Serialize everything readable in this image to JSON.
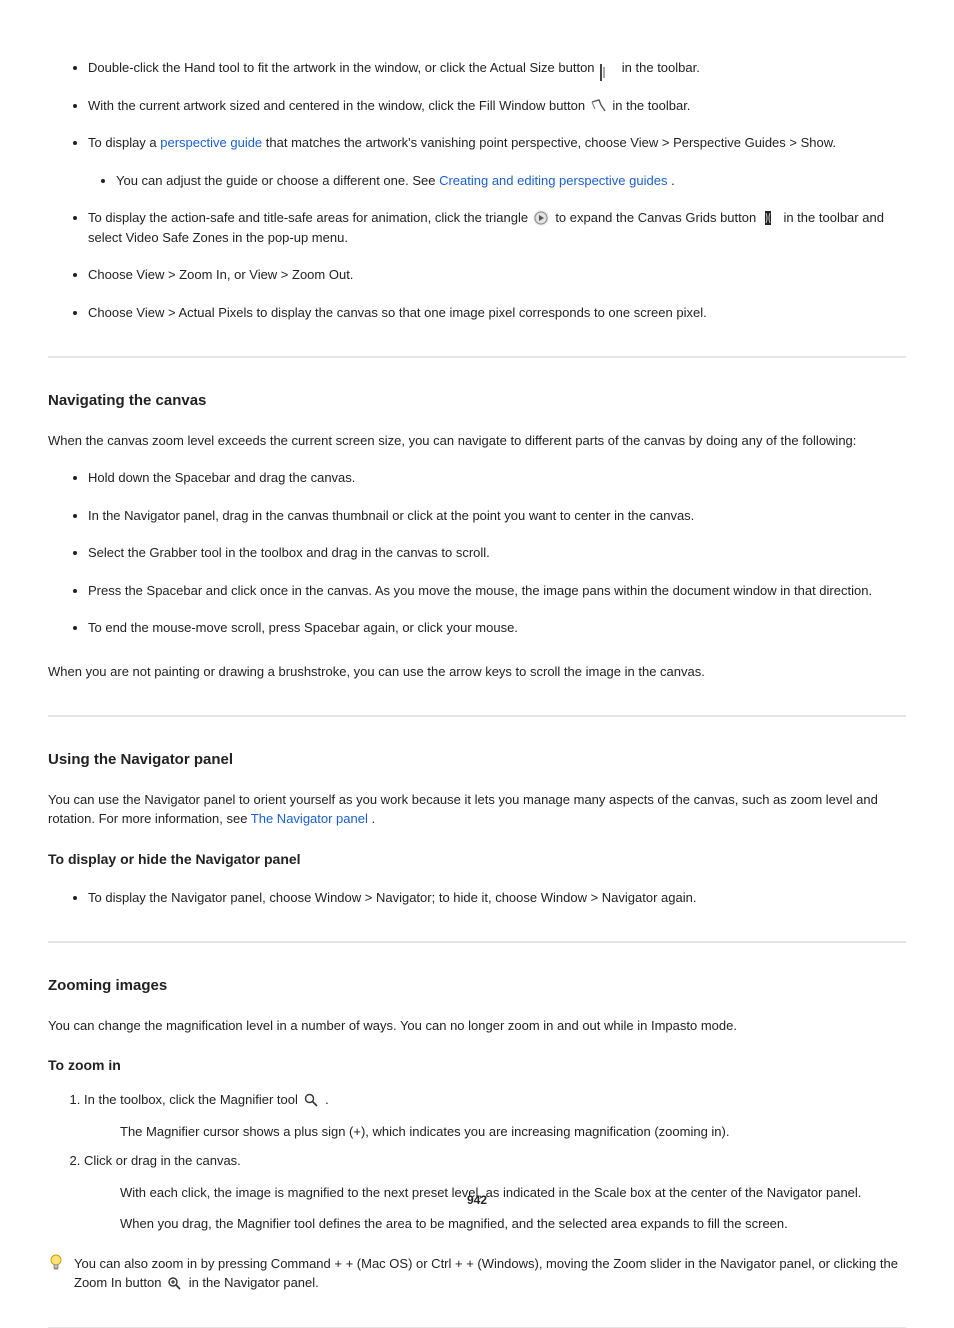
{
  "section1": {
    "items": [
      {
        "pre": "Double-click the Hand tool to fit the artwork in the window, or click the Actual Size button ",
        "post": " in the toolbar."
      },
      {
        "pre": "With the current artwork sized and centered in the window, click the Fill Window button ",
        "post": " in the toolbar."
      },
      {
        "line1_pre": "To display a ",
        "line1_link": "perspective guide",
        "line1_post": " that matches the artwork's vanishing point perspective, choose View > ",
        "line2": "Perspective Guides > Show.",
        "sub_text": "You can adjust the guide or choose a different one. See ",
        "sub_link": "Creating and editing perspective guides",
        "sub_post": "."
      },
      {
        "single_pre": "To display the action-safe and title-safe areas for animation, click the triangle ",
        "single_mid": " to expand the Canvas Grids button ",
        "single_post": " in the toolbar and select Video Safe Zones in the pop-up menu."
      },
      {
        "short1": "Choose View > Zoom In, or View > Zoom Out.",
        "short2": "Choose View > Actual Pixels to display the canvas so that one image pixel corresponds to one screen pixel."
      }
    ]
  },
  "section2": {
    "heading": "Navigating the canvas",
    "p1": "When the canvas zoom level exceeds the current screen size, you can navigate to different parts of the canvas by doing any of the following:",
    "steps": [
      "Hold down the Spacebar and drag the canvas.",
      "In the Navigator panel, drag in the canvas thumbnail or click at the point you want to center in the canvas.",
      "Select the Grabber tool in the toolbox and drag in the canvas to scroll.",
      "Press the Spacebar and click once in the canvas. As you move the mouse, the image pans within the document window in that direction.",
      "To end the mouse-move scroll, press Spacebar again, or click your mouse."
    ],
    "last": "When you are not painting or drawing a brushstroke, you can use the arrow keys to scroll the image in the canvas."
  },
  "section3": {
    "heading": "Using the Navigator panel",
    "p1": "You can use the Navigator panel to orient yourself as you work because it lets you manage many aspects of the canvas, such as zoom level and rotation. For more information, see ",
    "p1_link": "The Navigator panel",
    "p1_post": ".",
    "subheading": "To display or hide the Navigator panel",
    "step": "To display the Navigator panel, choose Window > Navigator; to hide it, choose Window > Navigator again."
  },
  "section4": {
    "heading": "Zooming images",
    "p1": "You can change the magnification level in a number of ways. You can no longer zoom in and out while in Impasto mode.",
    "subheading": "To zoom in",
    "step_pre": "In the toolbox, click the Magnifier tool ",
    "step_post": ".",
    "note": "The Magnifier cursor shows a plus sign (+), which indicates you are increasing magnification (zooming in).",
    "step2": "Click or drag in the canvas.",
    "after1": "With each click, the image is magnified to the next preset level, as indicated in the Scale box at the center of the Navigator panel.",
    "after2": "When you drag, the Magnifier tool defines the area to be magnified, and the selected area expands to fill the screen.",
    "tip_pre": "You can also zoom in by pressing Command + + (Mac OS) or Ctrl + + (Windows), moving the Zoom slider in the Navigator panel, or clicking the Zoom In button ",
    "tip_post": " in the Navigator panel."
  },
  "page_number": "942"
}
